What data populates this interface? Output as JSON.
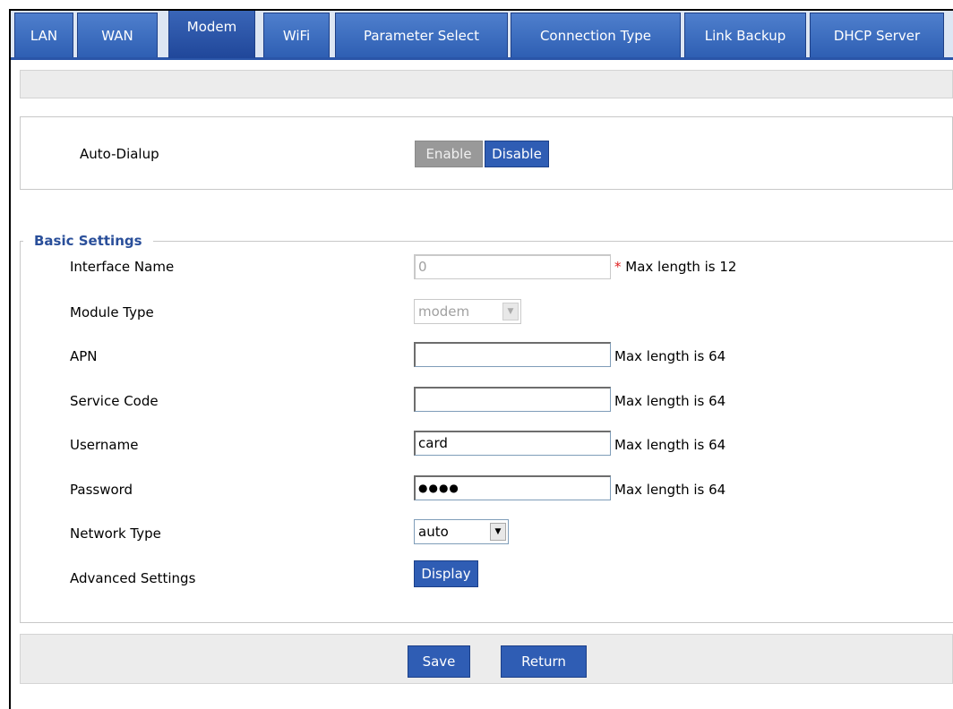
{
  "tabs": [
    {
      "label": "LAN"
    },
    {
      "label": "WAN"
    },
    {
      "label": "Modem"
    },
    {
      "label": "WiFi"
    },
    {
      "label": "Parameter Select"
    },
    {
      "label": "Connection Type"
    },
    {
      "label": "Link Backup"
    },
    {
      "label": "DHCP Server"
    }
  ],
  "active_tab": "Modem",
  "auto_dialup": {
    "label": "Auto-Dialup",
    "enable_label": "Enable",
    "disable_label": "Disable"
  },
  "basic_settings": {
    "legend": "Basic Settings",
    "interface_name": {
      "label": "Interface Name",
      "value": "0",
      "required_mark": "*",
      "hint": "Max length is 12"
    },
    "module_type": {
      "label": "Module Type",
      "value": "modem"
    },
    "apn": {
      "label": "APN",
      "value": "",
      "hint": "Max length is 64"
    },
    "service_code": {
      "label": "Service Code",
      "value": "",
      "hint": "Max length is 64"
    },
    "username": {
      "label": "Username",
      "value": "card",
      "hint": "Max length is 64"
    },
    "password": {
      "label": "Password",
      "value": "●●●●",
      "hint": "Max length is 64"
    },
    "network_type": {
      "label": "Network Type",
      "value": "auto"
    },
    "advanced_settings": {
      "label": "Advanced Settings",
      "button_label": "Display"
    }
  },
  "footer": {
    "save_label": "Save",
    "return_label": "Return"
  },
  "colors": {
    "tab_blue": "#2e5fb3",
    "button_blue": "#2f5db4",
    "legend_blue": "#2a4f9a",
    "required_red": "#e02020"
  }
}
